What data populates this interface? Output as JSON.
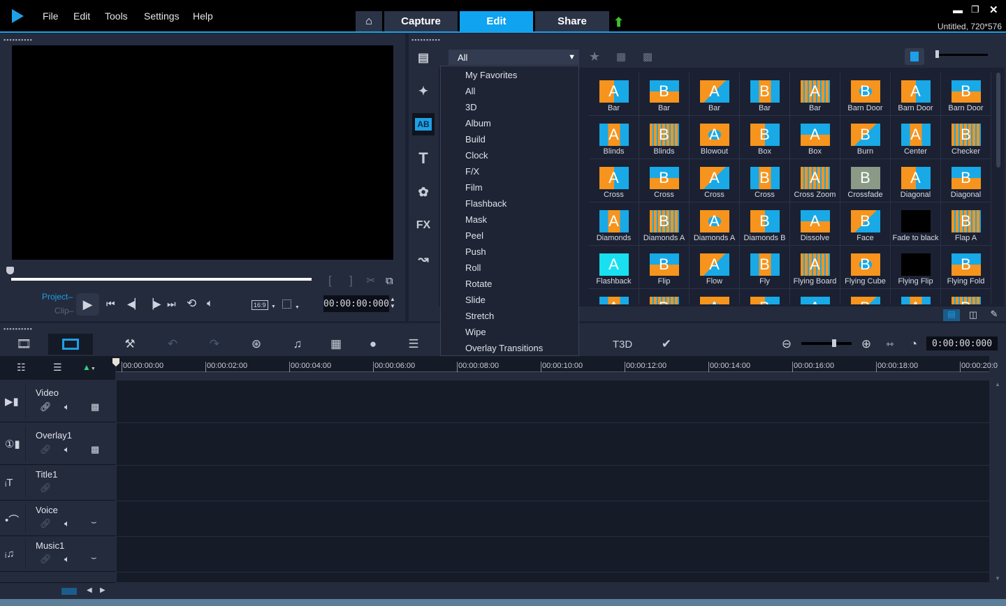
{
  "app": {
    "title_status": "Untitled, 720*576",
    "logo": "play-logo-icon"
  },
  "menu": [
    "File",
    "Edit",
    "Tools",
    "Settings",
    "Help"
  ],
  "tabs": {
    "home": "home-icon",
    "capture": "Capture",
    "edit": "Edit",
    "share": "Share",
    "upload": "upload-arrow-icon"
  },
  "preview": {
    "project_label": "Project",
    "clip_label": "Clip",
    "aspect": "16:9",
    "timecode": "00:00:00:000"
  },
  "library": {
    "filter_selected": "All",
    "dropdown_options": [
      "My Favorites",
      "All",
      "3D",
      "Album",
      "Build",
      "Clock",
      "F/X",
      "Film",
      "Flashback",
      "Mask",
      "Peel",
      "Push",
      "Roll",
      "Rotate",
      "Slide",
      "Stretch",
      "Wipe",
      "Overlay Transitions"
    ],
    "sidebar": [
      "media",
      "instant-project",
      "transition",
      "title",
      "graphic",
      "filter",
      "path"
    ],
    "items": [
      "Bar",
      "Bar",
      "Bar",
      "Bar",
      "Bar",
      "Barn Door",
      "Barn Door",
      "Barn Door",
      "Blinds",
      "Blinds",
      "Blowout",
      "Box",
      "Box",
      "Burn",
      "Center",
      "Checker",
      "Cross",
      "Cross",
      "Cross",
      "Cross",
      "Cross Zoom",
      "Crossfade",
      "Diagonal",
      "Diagonal",
      "Diamonds",
      "Diamonds A",
      "Diamonds A",
      "Diamonds B",
      "Dissolve",
      "Face",
      "Fade to black",
      "Flap A",
      "Flashback",
      "Flip",
      "Flow",
      "Fly",
      "Flying Board",
      "Flying Cube",
      "Flying Flip",
      "Flying Fold"
    ],
    "colors": {
      "orange": "#f7941d",
      "blue": "#19a9e6",
      "accent": "#0fa3f0"
    }
  },
  "timeline": {
    "timecode": "0:00:00:000",
    "ruler": [
      "00:00:00:00",
      "00:00:02:00",
      "00:00:04:00",
      "00:00:06:00",
      "00:00:08:00",
      "00:00:10:00",
      "00:00:12:00",
      "00:00:14:00",
      "00:00:16:00",
      "00:00:18:00",
      "00:00:20:0"
    ],
    "tracks": [
      "Video",
      "Overlay1",
      "Title1",
      "Voice",
      "Music1"
    ],
    "zoom_level": 0.75
  }
}
